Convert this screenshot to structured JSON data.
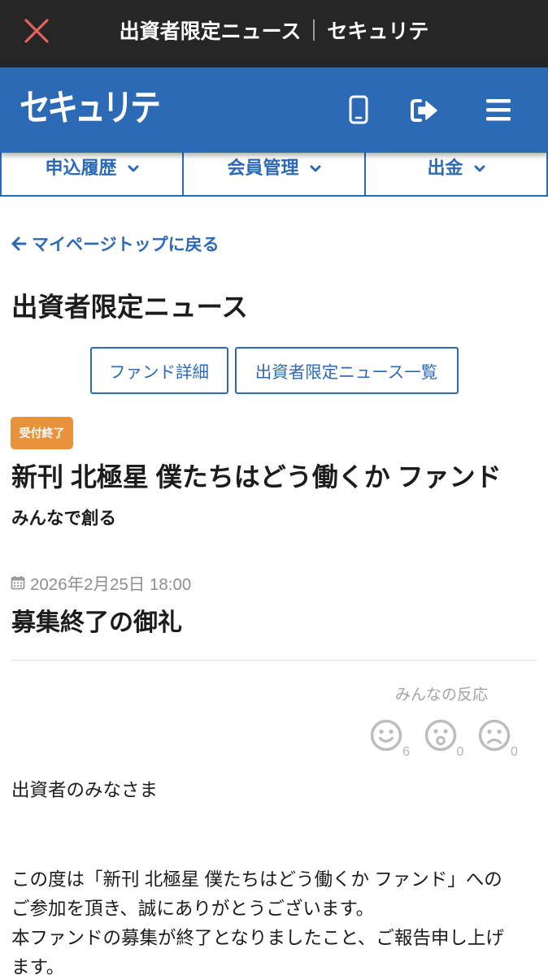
{
  "topbar": {
    "close_icon": "close-icon",
    "title_page": "出資者限定ニュース",
    "title_site": "セキュリテ"
  },
  "header": {
    "logo_text": "セキュリテ",
    "icons": [
      "mobile-icon",
      "sign-out-icon",
      "hamburger-menu-icon"
    ]
  },
  "nav": {
    "items": [
      {
        "label": "申込履歴",
        "icon": "chevron-down-icon"
      },
      {
        "label": "会員管理",
        "icon": "chevron-down-icon"
      },
      {
        "label": "出金",
        "icon": "chevron-down-icon"
      }
    ]
  },
  "back_link": {
    "label": "マイページトップに戻る",
    "icon": "arrow-left-icon"
  },
  "page_title": "出資者限定ニュース",
  "buttons": {
    "fund_detail": "ファンド詳細",
    "news_list": "出資者限定ニュース一覧"
  },
  "fund": {
    "status_badge": "受付終了",
    "title": "新刊 北極星 僕たちはどう働くか ファンド",
    "subtitle": "みんなで創る"
  },
  "news": {
    "date_icon": "calendar-icon",
    "date": "2026年2月25日 18:00",
    "title": "募集終了の御礼",
    "greeting": "出資者のみなさま",
    "body_lines": [
      "この度は「新刊 北極星 僕たちはどう働くか ファンド」への",
      "ご参加を頂き、誠にありがとうございます。",
      "本ファンドの募集が終了となりましたこと、ご報告申し上げ",
      "ます。"
    ]
  },
  "reactions": {
    "label": "みんなの反応",
    "items": [
      {
        "icon": "smile-icon",
        "count": 6
      },
      {
        "icon": "surprised-icon",
        "count": 0
      },
      {
        "icon": "sad-icon",
        "count": 0
      }
    ]
  },
  "colors": {
    "brand_blue": "#2d6ab6",
    "top_bar": "#262626",
    "close_icon": "#e0645c",
    "badge_orange": "#e8923c",
    "date_gray": "#8e8e8e",
    "reaction_gray": "#bdbdbd"
  }
}
